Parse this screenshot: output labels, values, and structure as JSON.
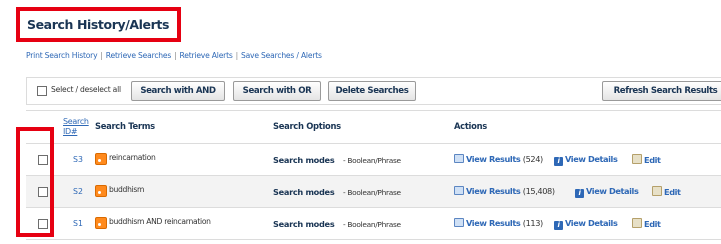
{
  "page_title": "Search History/Alerts",
  "links": [
    "Print Search History",
    "Retrieve Searches",
    "Retrieve Alerts",
    "Save Searches / Alerts"
  ],
  "toolbar": {
    "select_label": "Select / deselect all",
    "buttons": [
      "Search with AND",
      "Search with OR",
      "Delete Searches",
      "Refresh Search Results"
    ]
  },
  "table": {
    "headers": {
      "number": "Search ID#",
      "terms": "Search Terms",
      "options": "Search Options",
      "actions": "Actions"
    },
    "rows": [
      {
        "id": "S3",
        "term": "reincarnation",
        "mode_label": "Search modes",
        "mode_value": " - Boolean/Phrase",
        "view_label": "View Results",
        "count": "(524)",
        "details_label": "View Details",
        "edit_label": "Edit"
      },
      {
        "id": "S2",
        "term": "buddhism",
        "mode_label": "Search modes",
        "mode_value": " - Boolean/Phrase",
        "view_label": "View Results",
        "count": "(15,408)",
        "details_label": "View Details",
        "edit_label": "Edit"
      },
      {
        "id": "S1",
        "term": "buddhism AND reincarnation",
        "mode_label": "Search modes",
        "mode_value": " - Boolean/Phrase",
        "view_label": "View Results",
        "count": "(113)",
        "details_label": "View Details",
        "edit_label": "Edit"
      }
    ]
  },
  "icons": {
    "feed": "rss-icon",
    "view": "view-results-icon",
    "details": "info-icon",
    "edit": "edit-icon"
  },
  "colors": {
    "highlight": "#e60012",
    "link": "#2e68b6",
    "heading": "#1a3554"
  }
}
